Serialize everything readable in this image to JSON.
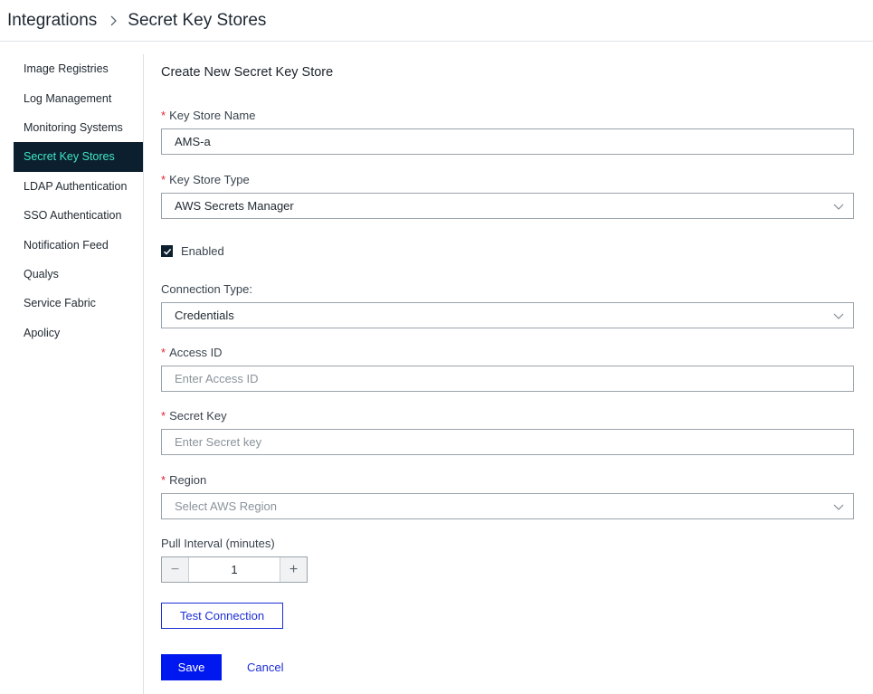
{
  "breadcrumb": {
    "parent": "Integrations",
    "current": "Secret Key Stores"
  },
  "sidebar": {
    "items": [
      {
        "label": "Image Registries"
      },
      {
        "label": "Log Management"
      },
      {
        "label": "Monitoring Systems"
      },
      {
        "label": "Secret Key Stores",
        "active": true
      },
      {
        "label": "LDAP Authentication"
      },
      {
        "label": "SSO Authentication"
      },
      {
        "label": "Notification Feed"
      },
      {
        "label": "Qualys"
      },
      {
        "label": "Service Fabric"
      },
      {
        "label": "Apolicy"
      }
    ]
  },
  "form": {
    "title": "Create New Secret Key Store",
    "required_marker": "*",
    "name": {
      "label": "Key Store Name",
      "value": "AMS-a"
    },
    "type": {
      "label": "Key Store Type",
      "value": "AWS Secrets Manager"
    },
    "enabled": {
      "label": "Enabled",
      "checked": true
    },
    "connection_type": {
      "label": "Connection Type:",
      "value": "Credentials"
    },
    "access_id": {
      "label": "Access ID",
      "placeholder": "Enter Access ID"
    },
    "secret_key": {
      "label": "Secret Key",
      "placeholder": "Enter Secret key"
    },
    "region": {
      "label": "Region",
      "placeholder": "Select AWS Region"
    },
    "pull_interval": {
      "label": "Pull Interval (minutes)",
      "value": "1",
      "minus": "−",
      "plus": "+"
    },
    "test_button": "Test Connection",
    "save_button": "Save",
    "cancel_button": "Cancel"
  },
  "colors": {
    "sidebar_active_bg": "#0c1f2e",
    "sidebar_active_text": "#3ee6c8",
    "primary": "#0018f0",
    "required": "#e0262f"
  }
}
